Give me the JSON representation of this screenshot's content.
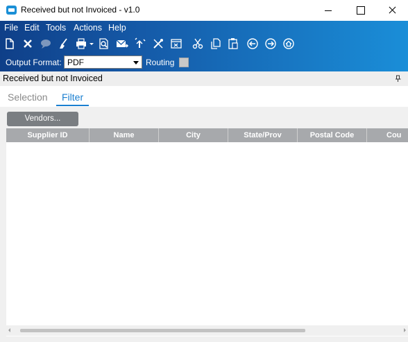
{
  "window": {
    "title": "Received but not Invoiced - v1.0"
  },
  "menu": {
    "items": [
      "File",
      "Edit",
      "Tools",
      "Actions",
      "Help"
    ]
  },
  "toolbar": {
    "icons": [
      "new-icon",
      "delete-icon",
      "comment-icon",
      "clear-icon",
      "print-icon",
      "print-preview-icon",
      "send-icon",
      "attach-icon",
      "tools-icon",
      "form-icon",
      "cut-icon",
      "copy-icon",
      "paste-icon",
      "back-icon",
      "forward-icon",
      "home-icon"
    ]
  },
  "output": {
    "format_label": "Output Format:",
    "format_value": "PDF",
    "routing_label": "Routing",
    "routing_checked": false
  },
  "panel": {
    "title": "Received but not Invoiced"
  },
  "tabs": {
    "selection": "Selection",
    "filter": "Filter",
    "active": "Filter"
  },
  "filter": {
    "vendors_button": "Vendors...",
    "columns": [
      "Supplier ID",
      "Name",
      "City",
      "State/Prov",
      "Postal Code",
      "Cou"
    ],
    "rows": []
  },
  "colors": {
    "accent": "#1a7fd0",
    "band_start": "#0f3f88",
    "band_end": "#1a8ed8",
    "grid_header": "#a7a9ac"
  }
}
